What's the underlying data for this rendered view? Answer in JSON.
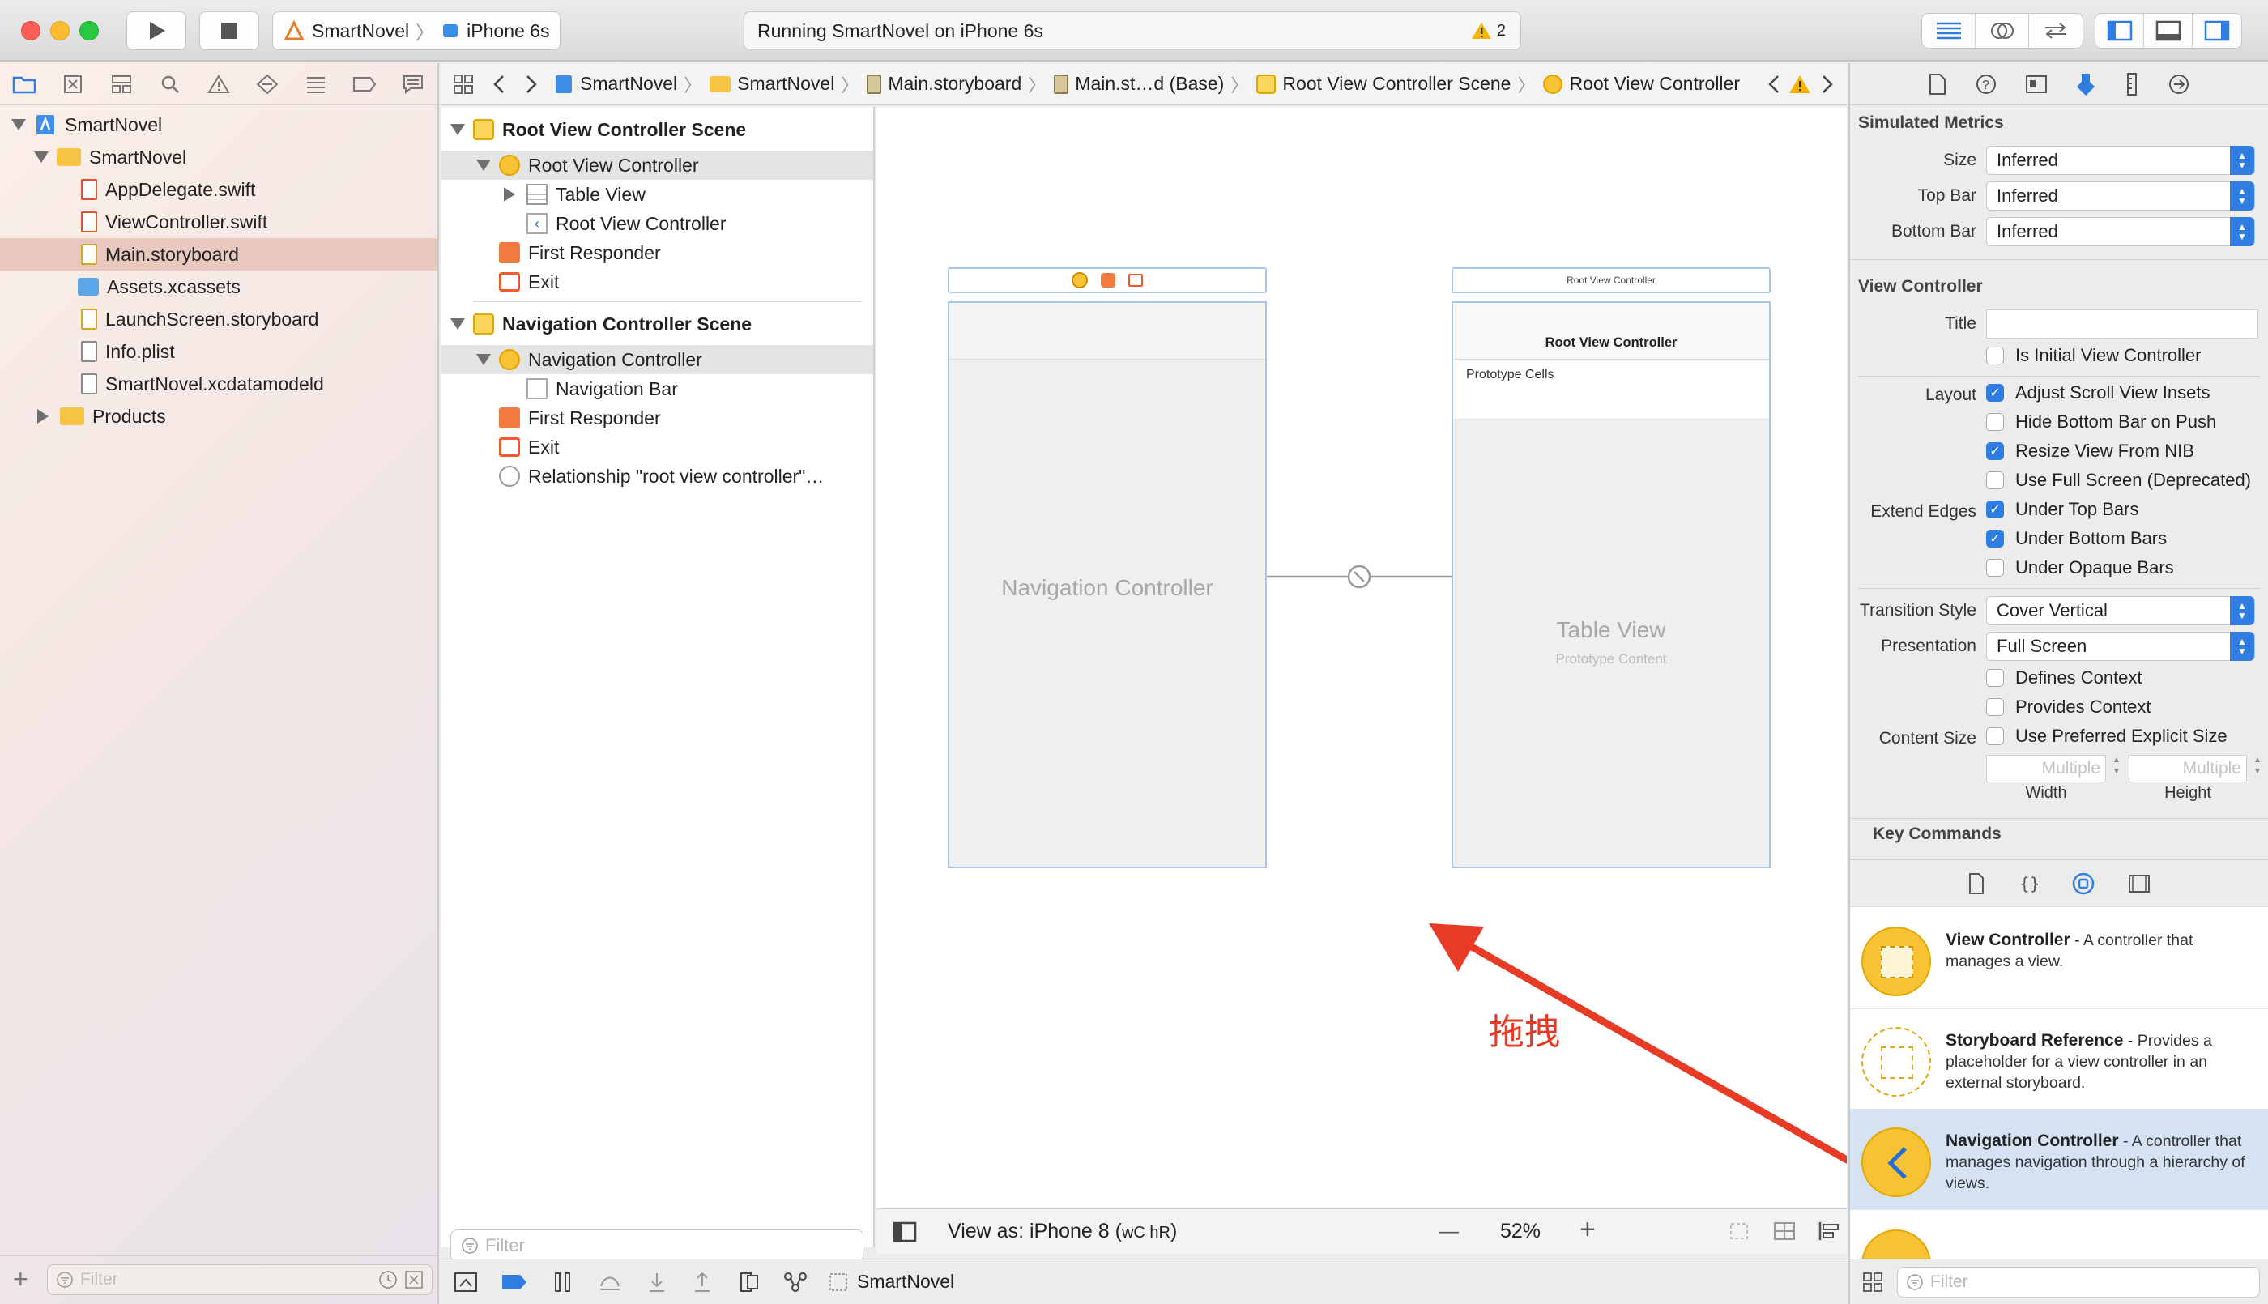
{
  "toolbar": {
    "scheme_name": "SmartNovel",
    "device_name": "iPhone 6s",
    "status_text": "Running SmartNovel on iPhone 6s",
    "warning_count": "2"
  },
  "navigator": {
    "items": [
      {
        "label": "SmartNovel"
      },
      {
        "label": "SmartNovel"
      },
      {
        "label": "AppDelegate.swift"
      },
      {
        "label": "ViewController.swift"
      },
      {
        "label": "Main.storyboard"
      },
      {
        "label": "Assets.xcassets"
      },
      {
        "label": "LaunchScreen.storyboard"
      },
      {
        "label": "Info.plist"
      },
      {
        "label": "SmartNovel.xcdatamodeld"
      },
      {
        "label": "Products"
      }
    ],
    "filter_placeholder": "Filter"
  },
  "jumpbar": {
    "crumbs": [
      "SmartNovel",
      "SmartNovel",
      "Main.storyboard",
      "Main.st…d (Base)",
      "Root View Controller Scene",
      "Root View Controller"
    ]
  },
  "outline": {
    "rows": [
      {
        "label": "Root View Controller Scene"
      },
      {
        "label": "Root View Controller"
      },
      {
        "label": "Table View"
      },
      {
        "label": "Root View Controller"
      },
      {
        "label": "First Responder"
      },
      {
        "label": "Exit"
      },
      {
        "label": "Navigation Controller Scene"
      },
      {
        "label": "Navigation Controller"
      },
      {
        "label": "Navigation Bar"
      },
      {
        "label": "First Responder"
      },
      {
        "label": "Exit"
      },
      {
        "label": "Relationship \"root view controller\"…"
      }
    ],
    "filter_placeholder": "Filter"
  },
  "canvas": {
    "nav_controller_title": "Navigation Controller",
    "root_bar_title": "Root View Controller",
    "root_nav_title": "Root View Controller",
    "prototype_cells": "Prototype Cells",
    "table_view_title": "Table View",
    "table_view_subtitle": "Prototype Content",
    "view_as": "View as: iPhone 8 (",
    "view_as_size": "wC hR",
    "view_as_end": ")",
    "zoom": "52%",
    "zoom_minus": "—",
    "zoom_plus": "+"
  },
  "debugbar": {
    "target": "SmartNovel"
  },
  "inspector": {
    "simulated_metrics_title": "Simulated Metrics",
    "size_label": "Size",
    "size_value": "Inferred",
    "topbar_label": "Top Bar",
    "topbar_value": "Inferred",
    "bottombar_label": "Bottom Bar",
    "bottombar_value": "Inferred",
    "view_controller_title": "View Controller",
    "title_label": "Title",
    "initial_vc": "Is Initial View Controller",
    "layout_label": "Layout",
    "adjust_scroll": "Adjust Scroll View Insets",
    "hide_bottom_bar": "Hide Bottom Bar on Push",
    "resize_view": "Resize View From NIB",
    "full_screen": "Use Full Screen (Deprecated)",
    "extend_edges_label": "Extend Edges",
    "under_top": "Under Top Bars",
    "under_bottom": "Under Bottom Bars",
    "under_opaque": "Under Opaque Bars",
    "transition_label": "Transition Style",
    "transition_value": "Cover Vertical",
    "presentation_label": "Presentation",
    "presentation_value": "Full Screen",
    "defines_context": "Defines Context",
    "provides_context": "Provides Context",
    "content_size_label": "Content Size",
    "preferred_size": "Use Preferred Explicit Size",
    "width_placeholder": "Multiple",
    "height_placeholder": "Multiple",
    "width_label": "Width",
    "height_label": "Height",
    "key_commands_title": "Key Commands"
  },
  "library": {
    "items": [
      {
        "title": "View Controller",
        "desc": " - A controller that manages a view."
      },
      {
        "title": "Storyboard Reference",
        "desc": " - Provides a placeholder for a view controller in an external storyboard."
      },
      {
        "title": "Navigation Controller",
        "desc": " - A controller that manages navigation through a hierarchy of views."
      }
    ],
    "filter_placeholder": "Filter"
  },
  "annotation": {
    "text": "拖拽"
  },
  "colors": {
    "accent": "#2f7de1",
    "annotation_red": "#e73b25",
    "selection_peach": "#e9c9bf",
    "storyboard_yellow": "#f7c233"
  }
}
